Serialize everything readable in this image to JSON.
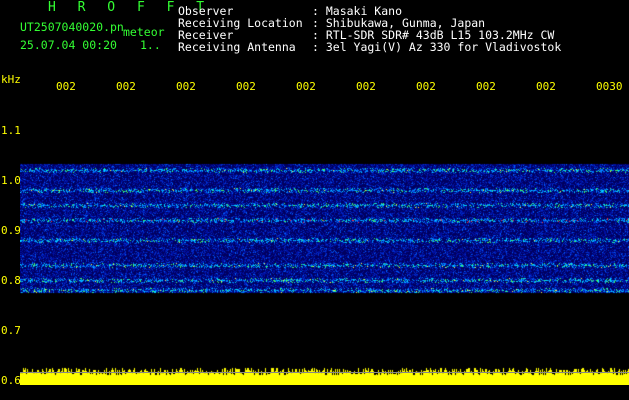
{
  "header": {
    "app_title": "H R O F F T",
    "filename": "UT2507040020.pn",
    "event": "meteor",
    "timestamp": "25.07.04 00:20",
    "count": "1..",
    "fields": [
      {
        "label": "Observer",
        "value": ": Masaki Kano"
      },
      {
        "label": "Receiving Location",
        "value": ": Shibukawa, Gunma, Japan"
      },
      {
        "label": "Receiver",
        "value": ": RTL-SDR SDR# 43dB L15 103.2MHz CW"
      },
      {
        "label": "Receiving Antenna",
        "value": ": 3el Yagi(V) Az 330 for Vladivostok"
      }
    ]
  },
  "axes": {
    "y_unit": "kHz",
    "y_ticks": [
      "1.1",
      "1.0",
      "0.9",
      "0.8",
      "0.7",
      "0.6"
    ],
    "x_ticks": [
      "002",
      "002",
      "002",
      "002",
      "002",
      "002",
      "002",
      "002",
      "002",
      "0030"
    ]
  },
  "colors": {
    "header_text": "#ffffff",
    "title": "#33ff33",
    "ticks": "#ffff00",
    "background": "#000000",
    "spectrum_bg": "#000033",
    "power_bar": "#ffff00"
  },
  "spectrum": {
    "bands_khz": [
      1.02,
      0.98,
      0.95,
      0.92,
      0.88,
      0.83,
      0.8,
      0.78
    ],
    "band_top_khz": 1.03,
    "band_bottom_khz": 0.775
  }
}
